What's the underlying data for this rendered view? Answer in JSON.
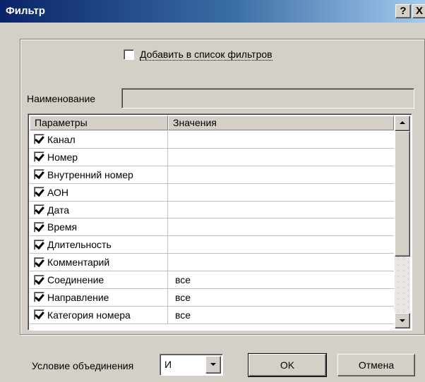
{
  "window": {
    "title": "Фильтр",
    "help_label": "?",
    "close_label": "X"
  },
  "add_to_filters": {
    "label": "Добавить в список фильтров",
    "checked": false
  },
  "name_field": {
    "label": "Наименование",
    "value": ""
  },
  "table": {
    "columns": [
      "Параметры",
      "Значения"
    ],
    "rows": [
      {
        "param": "Канал",
        "value": "",
        "checked": true
      },
      {
        "param": "Номер",
        "value": "",
        "checked": true
      },
      {
        "param": "Внутренний номер",
        "value": "",
        "checked": true
      },
      {
        "param": "АОН",
        "value": "",
        "checked": true
      },
      {
        "param": "Дата",
        "value": "",
        "checked": true
      },
      {
        "param": "Время",
        "value": "",
        "checked": true
      },
      {
        "param": "Длительность",
        "value": "",
        "checked": true
      },
      {
        "param": "Комментарий",
        "value": "",
        "checked": true
      },
      {
        "param": "Соединение",
        "value": "все",
        "checked": true
      },
      {
        "param": "Направление",
        "value": "все",
        "checked": true
      },
      {
        "param": "Категория номера",
        "value": "все",
        "checked": true
      }
    ]
  },
  "footer": {
    "condition_label": "Условие объединения",
    "condition_value": "И",
    "ok_label": "OK",
    "cancel_label": "Отмена"
  }
}
